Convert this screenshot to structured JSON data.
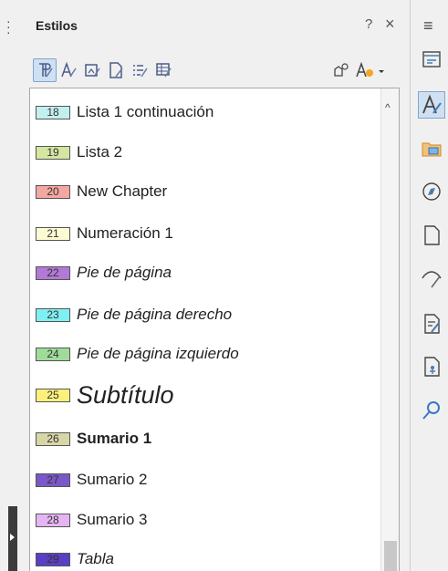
{
  "panel": {
    "title": "Estilos",
    "help_label": "?",
    "close_label": "×"
  },
  "deck_menu_label": "≡",
  "toolbar": {
    "buttons": [
      {
        "name": "paragraph-styles-icon",
        "selected": true
      },
      {
        "name": "character-styles-icon",
        "selected": false
      },
      {
        "name": "frame-styles-icon",
        "selected": false
      },
      {
        "name": "page-styles-icon",
        "selected": false
      },
      {
        "name": "list-styles-icon",
        "selected": false
      },
      {
        "name": "table-styles-icon",
        "selected": false
      },
      {
        "name": "fill-format-mode-icon",
        "selected": false
      },
      {
        "name": "new-style-from-selection-icon",
        "selected": false
      }
    ]
  },
  "styles": [
    {
      "num": "18",
      "label": "Lista 1 continuación",
      "color": "#c2f0ee",
      "font": "normal"
    },
    {
      "num": "19",
      "label": "Lista 2",
      "color": "#d5e6a1",
      "font": "normal"
    },
    {
      "num": "20",
      "label": "New Chapter",
      "color": "#f4a7a0",
      "font": "normal"
    },
    {
      "num": "21",
      "label": "Numeración 1",
      "color": "#fdfbd2",
      "font": "normal"
    },
    {
      "num": "22",
      "label": "Pie de página",
      "color": "#b279d6",
      "font": "italic"
    },
    {
      "num": "23",
      "label": "Pie de página derecho",
      "color": "#7ef0f2",
      "font": "italic"
    },
    {
      "num": "24",
      "label": "Pie de página izquierdo",
      "color": "#9fdc9a",
      "font": "italic"
    },
    {
      "num": "25",
      "label": "Subtítulo",
      "color": "#fcf07a",
      "font": "subtitle"
    },
    {
      "num": "26",
      "label": "Sumario 1",
      "color": "#d7d6a6",
      "font": "bold"
    },
    {
      "num": "27",
      "label": "Sumario 2",
      "color": "#7a58c8",
      "font": "normal"
    },
    {
      "num": "28",
      "label": "Sumario 3",
      "color": "#e4b5f2",
      "font": "normal"
    },
    {
      "num": "29",
      "label": "Tabla",
      "color": "#5a3fc2",
      "font": "italic"
    }
  ],
  "deck": {
    "buttons": [
      {
        "name": "properties-icon",
        "selected": false
      },
      {
        "name": "styles-icon",
        "selected": true
      },
      {
        "name": "gallery-icon",
        "selected": false
      },
      {
        "name": "navigator-icon",
        "selected": false
      },
      {
        "name": "page-icon",
        "selected": false
      },
      {
        "name": "style-inspector-icon",
        "selected": false
      },
      {
        "name": "manage-changes-icon",
        "selected": false
      },
      {
        "name": "design-icon",
        "selected": false
      },
      {
        "name": "find-icon",
        "selected": false
      }
    ]
  }
}
